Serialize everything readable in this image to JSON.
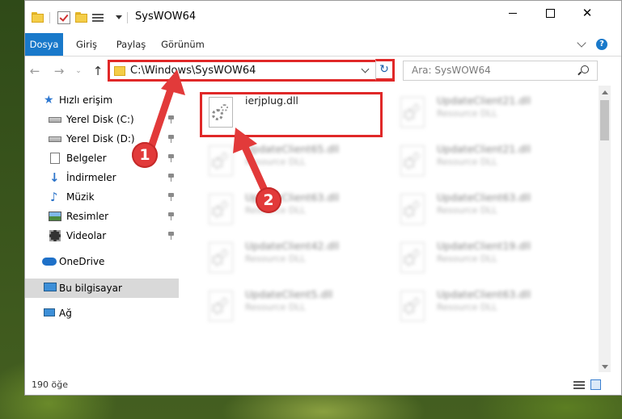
{
  "window": {
    "title": "SysWOW64"
  },
  "quick_access_toolbar": {
    "icons": [
      "folder-icon",
      "checkmark-properties-icon",
      "new-folder-icon",
      "properties-icon",
      "customize-dropdown-icon"
    ]
  },
  "title_controls": {
    "minimize": "minimize",
    "maximize": "maximize",
    "close": "✕"
  },
  "ribbon": {
    "tabs": [
      {
        "label": "Dosya",
        "active": true
      },
      {
        "label": "Giriş"
      },
      {
        "label": "Paylaş"
      },
      {
        "label": "Görünüm"
      }
    ],
    "help": "?"
  },
  "navigation": {
    "back": "←",
    "forward": "→",
    "recent": "⌄",
    "up": "↑"
  },
  "address_bar": {
    "path": "C:\\Windows\\SysWOW64",
    "refresh": "↻"
  },
  "search": {
    "placeholder": "Ara: SysWOW64"
  },
  "sidebar": {
    "items": [
      {
        "label": "Hızlı erişim",
        "icon": "star-icon"
      },
      {
        "label": "Yerel Disk (C:)",
        "icon": "drive-icon",
        "pinned": true
      },
      {
        "label": "Yerel Disk (D:)",
        "icon": "drive-icon",
        "pinned": true
      },
      {
        "label": "Belgeler",
        "icon": "document-icon",
        "pinned": true
      },
      {
        "label": "İndirmeler",
        "icon": "download-icon",
        "pinned": true
      },
      {
        "label": "Müzik",
        "icon": "music-icon",
        "pinned": true
      },
      {
        "label": "Resimler",
        "icon": "pictures-icon",
        "pinned": true
      },
      {
        "label": "Videolar",
        "icon": "video-icon",
        "pinned": true
      },
      {
        "label": "OneDrive",
        "icon": "cloud-icon"
      },
      {
        "label": "Bu bilgisayar",
        "icon": "computer-icon",
        "selected": true
      },
      {
        "label": "Ağ",
        "icon": "network-icon"
      }
    ]
  },
  "files": [
    {
      "name": "ierjplug.dll",
      "type": ""
    },
    {
      "name": "UpdateClient21.dll",
      "type": "Resource DLL"
    },
    {
      "name": "UpdateClient65.dll",
      "type": "Resource DLL"
    },
    {
      "name": "UpdateClient21.dll",
      "type": "Resource DLL"
    },
    {
      "name": "UpdateClient63.dll",
      "type": "Resource DLL"
    },
    {
      "name": "UpdateClient63.dll",
      "type": "Resource DLL"
    },
    {
      "name": "UpdateClient42.dll",
      "type": "Resource DLL"
    },
    {
      "name": "UpdateClient19.dll",
      "type": "Resource DLL"
    },
    {
      "name": "UpdateClient5.dll",
      "type": "Resource DLL"
    },
    {
      "name": "UpdateClient63.dll",
      "type": "Resource DLL"
    }
  ],
  "status_bar": {
    "item_count": "190 öğe"
  },
  "callouts": [
    {
      "number": "1"
    },
    {
      "number": "2"
    }
  ],
  "colors": {
    "accent": "#1979ca",
    "callout": "#e23a3a"
  }
}
